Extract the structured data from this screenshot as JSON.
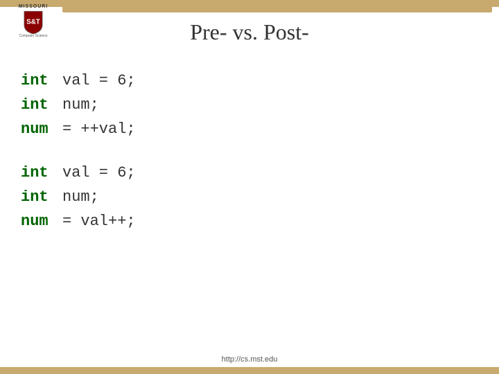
{
  "topBar": {
    "color": "#c8a96e"
  },
  "logo": {
    "missouri": "MISSOURI",
    "subtitle": "Computer Science",
    "shieldColor": "#8B0000"
  },
  "title": "Pre- vs. Post-",
  "codeBlock1": {
    "line1_kw": "int",
    "line1_rest": "val = 6;",
    "line2_kw": "int",
    "line2_rest": "num;",
    "line3_kw": "num",
    "line3_rest": "= ++val;"
  },
  "codeBlock2": {
    "line1_kw": "int",
    "line1_rest": "val = 6;",
    "line2_kw": "int",
    "line2_rest": "num;",
    "line3_kw": "num",
    "line3_rest": "= val++;"
  },
  "footer": {
    "url": "http://cs.mst.edu"
  }
}
